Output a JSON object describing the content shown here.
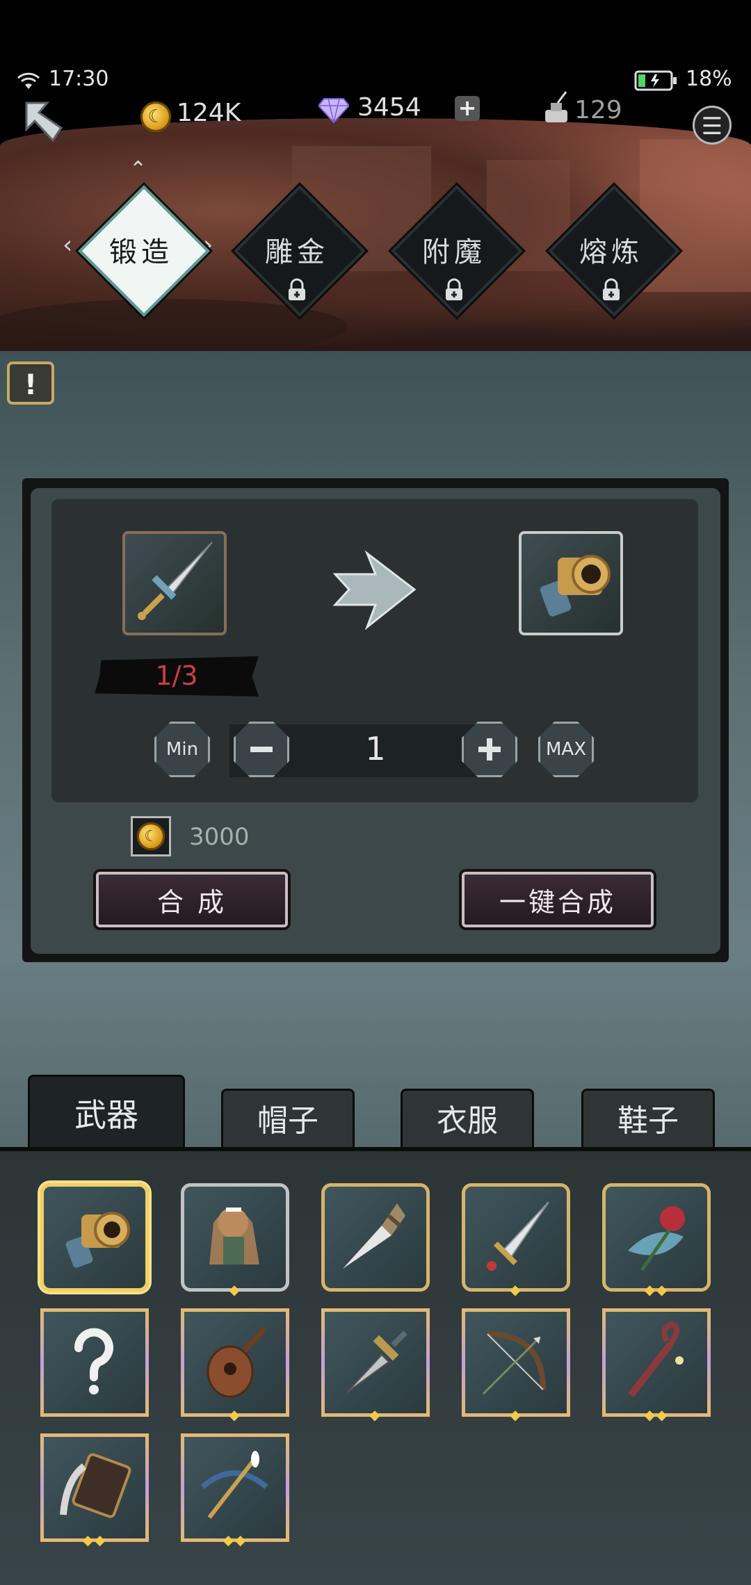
{
  "status": {
    "time": "17:30",
    "battery": "18%"
  },
  "resources": {
    "gold": "124K",
    "gems": "3454",
    "ink": "129"
  },
  "forge_tabs": [
    {
      "label": "锻造",
      "active": true,
      "locked": false
    },
    {
      "label": "雕金",
      "active": false,
      "locked": true
    },
    {
      "label": "附魔",
      "active": false,
      "locked": true
    },
    {
      "label": "熔炼",
      "active": false,
      "locked": true
    }
  ],
  "forge": {
    "material_count": "1/3",
    "quantity": "1",
    "min_label": "Min",
    "max_label": "MAX",
    "cost": "3000",
    "synthesize_label": "合 成",
    "synthesize_all_label": "一键合成"
  },
  "category_tabs": [
    "武器",
    "帽子",
    "衣服",
    "鞋子"
  ],
  "items": [
    {
      "icon": "cannon-icon",
      "stars": 0,
      "selected": true
    },
    {
      "icon": "maid-doll-icon",
      "stars": 1
    },
    {
      "icon": "bone-blade-icon",
      "stars": 0
    },
    {
      "icon": "sword-icon",
      "stars": 1
    },
    {
      "icon": "rose-icon",
      "stars": 2
    },
    {
      "icon": "question-icon",
      "stars": 0
    },
    {
      "icon": "lute-icon",
      "stars": 1
    },
    {
      "icon": "dagger-icon",
      "stars": 1
    },
    {
      "icon": "bow-icon",
      "stars": 1
    },
    {
      "icon": "staff-icon",
      "stars": 2
    },
    {
      "icon": "book-icon",
      "stars": 2
    },
    {
      "icon": "crossbow-icon",
      "stars": 2
    }
  ],
  "colors": {
    "count_red": "#cc3e45",
    "gold_star": "#f3c94a",
    "select_border": "#f2d064"
  }
}
